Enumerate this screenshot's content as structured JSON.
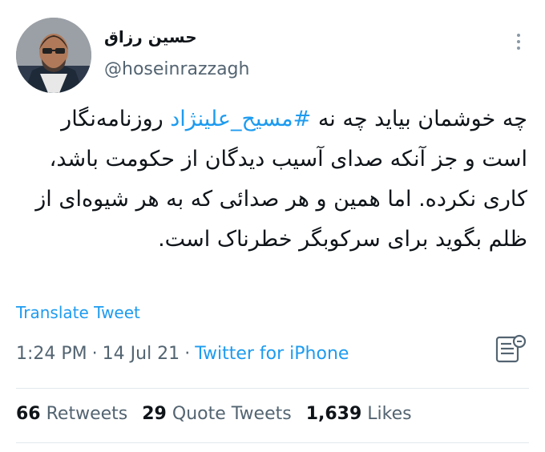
{
  "tweet": {
    "display_name": "حسین رزاق",
    "handle": "@hoseinrazzagh",
    "text_pre": "چه خوشمان بیاید چه نه ",
    "hashtag": "#مسیح_علینژاد",
    "text_post": " روزنامه‌نگار است و جز آنکه صدای آسیب دیدگان از حکومت باشد، کاری نکرده. اما همین و هر صدائی که به هر شیوه‌ای از ظلم بگوید برای سرکوبگر خطرناک است.",
    "translate_label": "Translate Tweet",
    "time": "1:24 PM",
    "date": "14 Jul 21",
    "source": "Twitter for iPhone",
    "separator": "·"
  },
  "stats": {
    "retweets_count": "66",
    "retweets_label": "Retweets",
    "quotes_count": "29",
    "quotes_label": "Quote Tweets",
    "likes_count": "1,639",
    "likes_label": "Likes"
  },
  "icons": {
    "more": "more-vertical-icon",
    "analytics": "analytics-icon"
  },
  "colors": {
    "link": "#1d9bf0",
    "secondary_text": "#536471",
    "primary_text": "#0f1419"
  }
}
